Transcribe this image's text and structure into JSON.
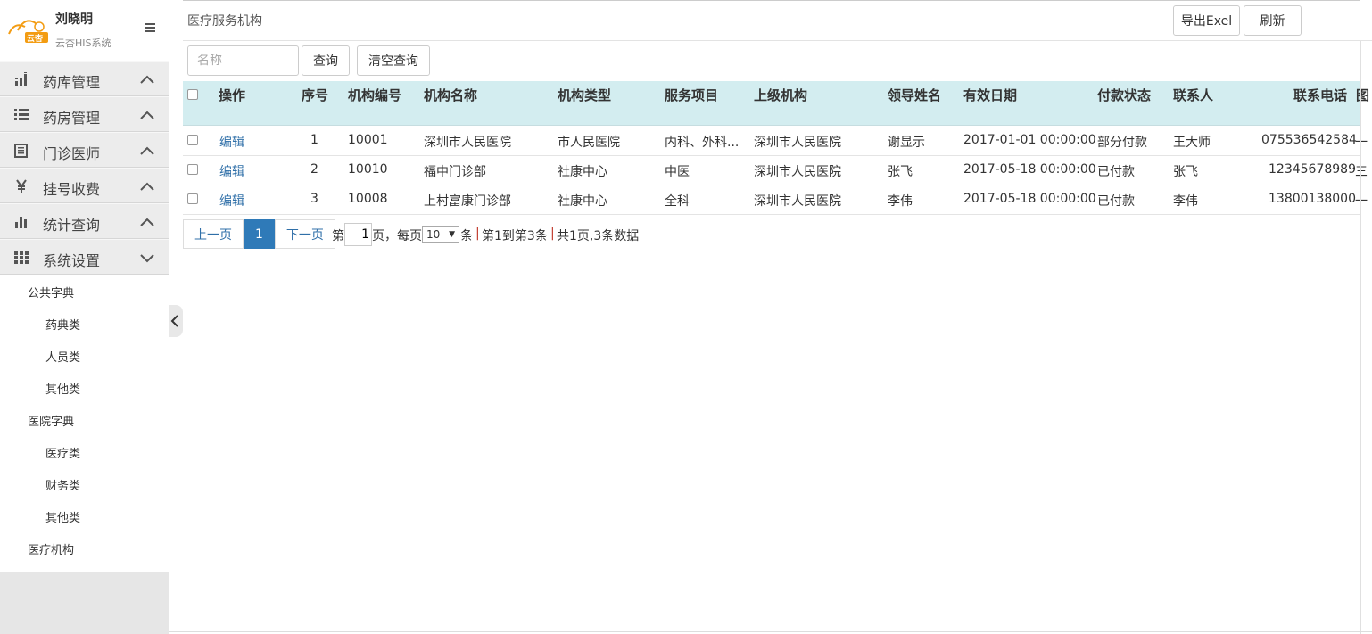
{
  "sidebar": {
    "user_name": "刘晓明",
    "system_name": "云杏HIS系统",
    "logo_text": "云杏",
    "menu": [
      {
        "label": "药库管理",
        "icon": "bar-chart-icon",
        "state": "collapsed"
      },
      {
        "label": "药房管理",
        "icon": "list-icon",
        "state": "collapsed"
      },
      {
        "label": "门诊医师",
        "icon": "document-icon",
        "state": "collapsed"
      },
      {
        "label": "挂号收费",
        "icon": "yen-icon",
        "state": "collapsed"
      },
      {
        "label": "统计查询",
        "icon": "column-chart-icon",
        "state": "collapsed"
      },
      {
        "label": "系统设置",
        "icon": "grid-icon",
        "state": "expanded"
      }
    ],
    "submenu": [
      {
        "label": "公共字典",
        "level": 1
      },
      {
        "label": "药典类",
        "level": 2
      },
      {
        "label": "人员类",
        "level": 2
      },
      {
        "label": "其他类",
        "level": 2
      },
      {
        "label": "医院字典",
        "level": 1
      },
      {
        "label": "医疗类",
        "level": 2
      },
      {
        "label": "财务类",
        "level": 2
      },
      {
        "label": "其他类",
        "level": 2
      },
      {
        "label": "医疗机构",
        "level": 1
      }
    ]
  },
  "header": {
    "title": "医疗服务机构",
    "export_label": "导出Exel",
    "refresh_label": "刷新"
  },
  "search": {
    "placeholder": "名称",
    "value": "",
    "query_label": "查询",
    "clear_label": "清空查询"
  },
  "table": {
    "columns": [
      "操作",
      "序号",
      "机构编号",
      "机构名称",
      "机构类型",
      "服务项目",
      "上级机构",
      "领导姓名",
      "有效日期",
      "付款状态",
      "联系人",
      "联系电话",
      "图"
    ],
    "rows": [
      {
        "action": "编辑",
        "index": "1",
        "code": "10001",
        "name": "深圳市人民医院",
        "type": "市人民医院",
        "service": "内科、外科...",
        "parent": "深圳市人民医院",
        "leader": "谢显示",
        "date": "2017-01-01 00:00:00",
        "pay": "部分付款",
        "contact": "王大师",
        "phone": "075536542584",
        "extra": "一"
      },
      {
        "action": "编辑",
        "index": "2",
        "code": "10010",
        "name": "福中门诊部",
        "type": "社康中心",
        "service": "中医",
        "parent": "深圳市人民医院",
        "leader": "张飞",
        "date": "2017-05-18 00:00:00",
        "pay": "已付款",
        "contact": "张飞",
        "phone": "12345678989",
        "extra": "三"
      },
      {
        "action": "编辑",
        "index": "3",
        "code": "10008",
        "name": "上村富康门诊部",
        "type": "社康中心",
        "service": "全科",
        "parent": "深圳市人民医院",
        "leader": "李伟",
        "date": "2017-05-18 00:00:00",
        "pay": "已付款",
        "contact": "李伟",
        "phone": "13800138000",
        "extra": "一"
      }
    ]
  },
  "pagination": {
    "prev_label": "上一页",
    "current_page": "1",
    "next_label": "下一页",
    "goto_prefix": "第",
    "goto_value": "1",
    "goto_suffix": "页，每页",
    "page_size": "10",
    "page_size_suffix": "条",
    "range_text": "第1到第3条",
    "total_text": "共1页,3条数据",
    "separator": "|"
  },
  "colors": {
    "header_bg": "#d3edf0",
    "link": "#2f6fa8",
    "active_page": "#2f7ab8",
    "logo_orange": "#f39c12"
  }
}
